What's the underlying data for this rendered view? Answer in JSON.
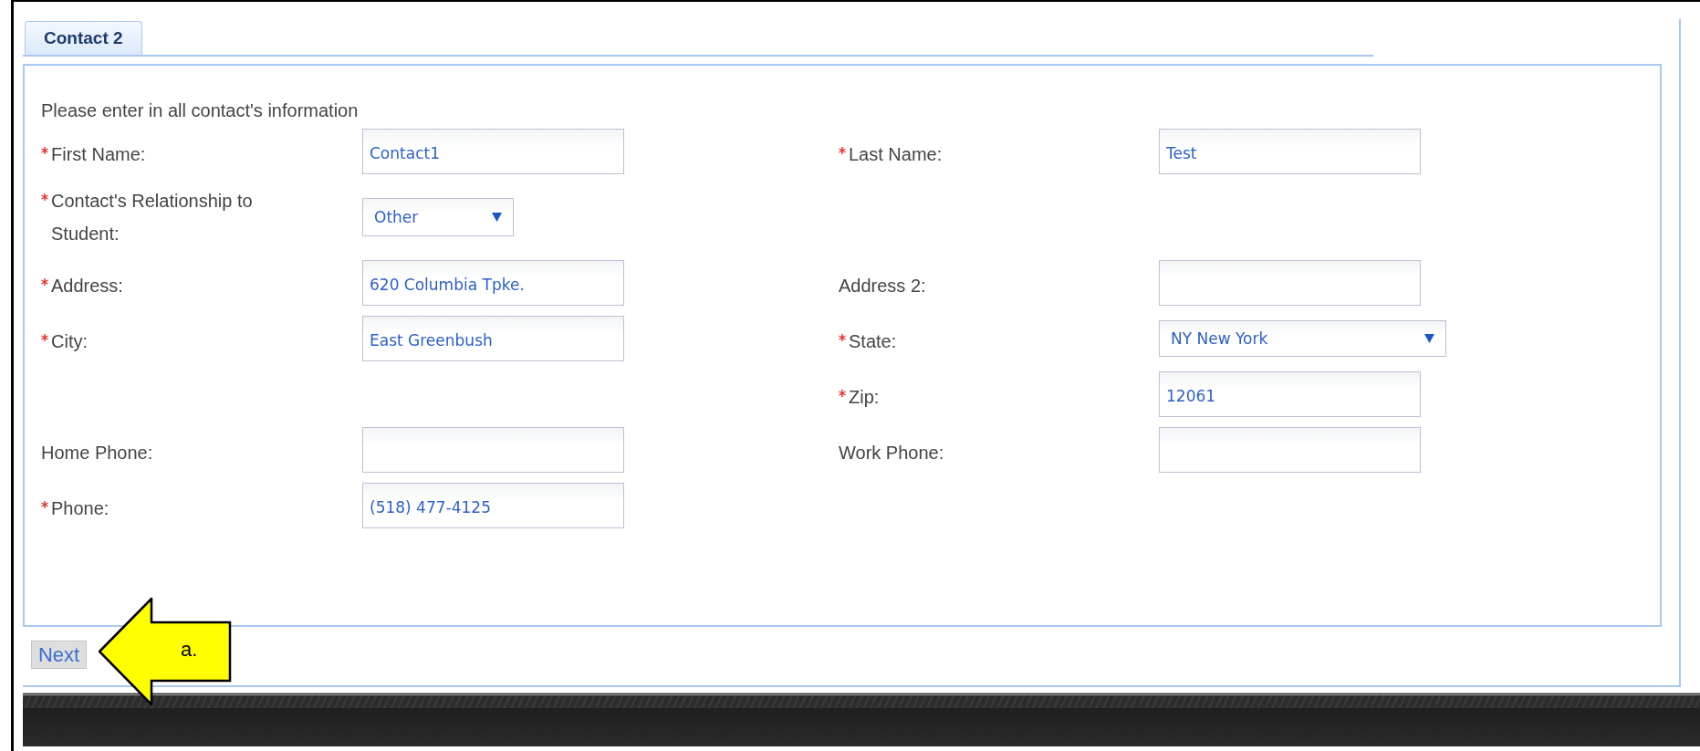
{
  "tabs": [
    {
      "label": "Contact 2",
      "selected": true
    }
  ],
  "intro": "Please enter in all contact's information",
  "rows": [
    {
      "left": {
        "label": "First Name:",
        "required": true,
        "kind": "text",
        "value": "Contact1"
      },
      "right": {
        "label": "Last Name:",
        "required": true,
        "kind": "text",
        "value": "Test"
      }
    },
    {
      "left": {
        "label": "Contact's Relationship to Student:",
        "required": true,
        "kind": "select",
        "value": "Other"
      }
    },
    {
      "left": {
        "label": "Address:",
        "required": true,
        "kind": "text",
        "value": "620 Columbia Tpke."
      },
      "right": {
        "label": "Address 2:",
        "required": false,
        "kind": "text"
      }
    },
    {
      "left": {
        "label": "City:",
        "required": true,
        "kind": "text",
        "value": "East Greenbush"
      },
      "right": {
        "label": "State:",
        "required": true,
        "kind": "select",
        "value": "NY New York"
      }
    },
    {
      "right": {
        "label": "Zip:",
        "required": true,
        "kind": "text",
        "value": "12061"
      }
    },
    {
      "left": {
        "label": "Home Phone:",
        "required": false,
        "kind": "text"
      },
      "right": {
        "label": "Work Phone:",
        "required": false,
        "kind": "text"
      }
    },
    {
      "left": {
        "label": "Phone:",
        "required": true,
        "kind": "text",
        "value": "(518) 477-4125"
      }
    }
  ],
  "next_button": "Next",
  "callout": {
    "label": "a."
  }
}
